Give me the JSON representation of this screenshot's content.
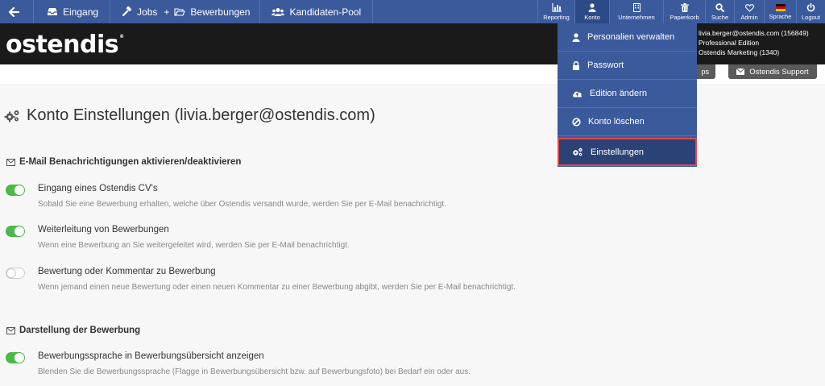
{
  "nav": {
    "eingang": "Eingang",
    "jobs": "Jobs",
    "plus": "+",
    "bewerbungen": "Bewerbungen",
    "kandidaten": "Kandidaten-Pool",
    "tools": {
      "reporting": "Reporting",
      "konto": "Konto",
      "unternehmen": "Unternehmen",
      "papierkorb": "Papierkorb",
      "suche": "Suche",
      "admin": "Admin",
      "sprache": "Sprache",
      "logout": "Logout"
    }
  },
  "header": {
    "logo": "ostendis",
    "logo_mark": "®",
    "user_email_line": "livia.berger@ostendis.com (156849)",
    "edition": "Professional Edition",
    "company": "Ostendis Marketing (1340)"
  },
  "subbar": {
    "apps_label": "ps",
    "support_label": "Ostendis Support"
  },
  "dropdown": {
    "items": [
      {
        "label": "Personalien verwalten",
        "icon": "user-icon"
      },
      {
        "label": "Passwort",
        "icon": "lock-icon"
      },
      {
        "label": "Edition ändern",
        "icon": "cloud-upload-icon"
      },
      {
        "label": "Konto löschen",
        "icon": "ban-icon"
      },
      {
        "label": "Einstellungen",
        "icon": "gears-icon"
      }
    ]
  },
  "page": {
    "title": "Konto Einstellungen (livia.berger@ostendis.com)"
  },
  "sections": {
    "email": {
      "heading": "E-Mail Benachrichtigungen aktivieren/deaktivieren",
      "settings": [
        {
          "label": "Eingang eines Ostendis CV's",
          "desc": "Sobald Sie eine Bewerbung erhalten, welche über Ostendis versandt wurde, werden Sie per E-Mail benachrichtigt.",
          "on": true
        },
        {
          "label": "Weiterleitung von Bewerbungen",
          "desc": "Wenn eine Bewerbung an Sie weitergeleitet wird, werden Sie per E-Mail benachrichtigt.",
          "on": true
        },
        {
          "label": "Bewertung oder Kommentar zu Bewerbung",
          "desc": "Wenn jemand einen neue Bewertung oder einen neuen Kommentar zu einer Bewerbung abgibt, werden Sie per E-Mail benachrichtigt.",
          "on": false
        }
      ]
    },
    "display": {
      "heading": "Darstellung der Bewerbung",
      "settings": [
        {
          "label": "Bewerbungssprache in Bewerbungsübersicht anzeigen",
          "desc": "Blenden Sie die Bewerbungssprache (Flagge in Bewerbungsübersicht bzw. auf Bewerbungsfoto) bei Bedarf ein oder aus.",
          "on": true
        }
      ]
    }
  },
  "colors": {
    "nav": "#3a5a9c",
    "header": "#1a1a1a",
    "toggle_on": "#4cb848",
    "highlight": "#e04848"
  }
}
